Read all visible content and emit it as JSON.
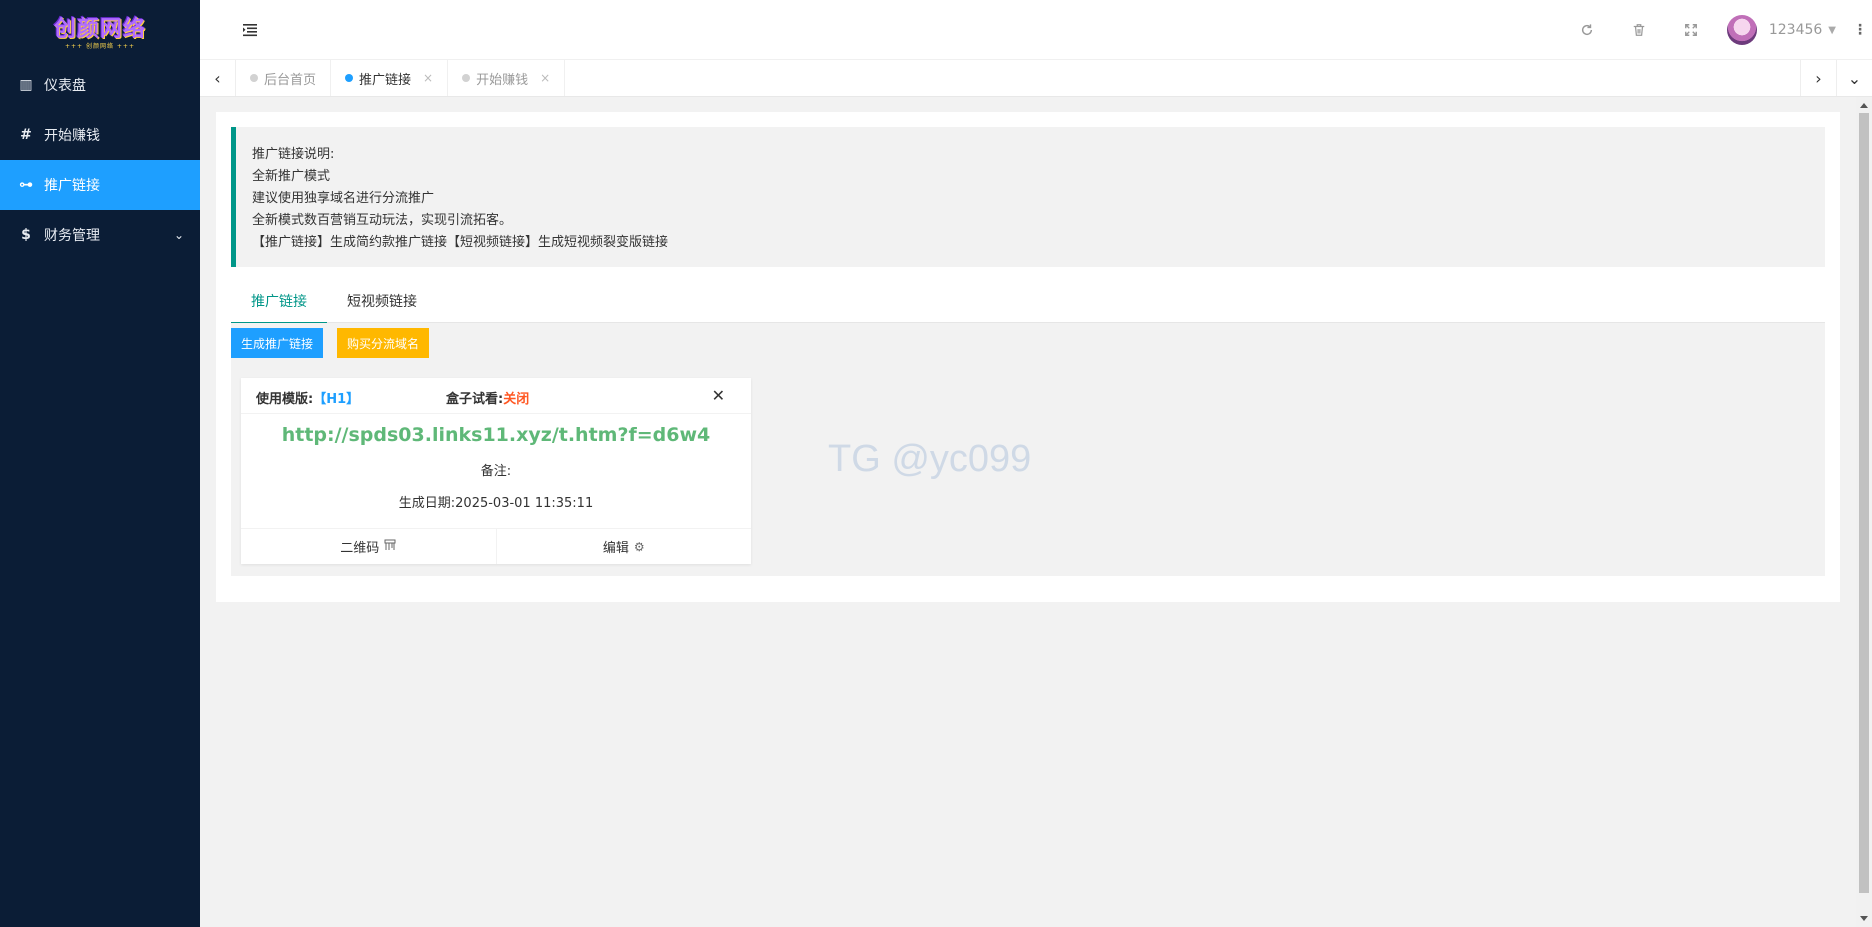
{
  "logo": {
    "title": "创颜网络",
    "subtitle": "+++ 创颜网络 +++"
  },
  "sidebar": {
    "items": [
      {
        "label": "仪表盘",
        "icon": "building-icon",
        "glyph": "▥"
      },
      {
        "label": "开始赚钱",
        "icon": "hash-icon",
        "glyph": "#"
      },
      {
        "label": "推广链接",
        "icon": "usb-icon",
        "glyph": "⊶"
      },
      {
        "label": "财务管理",
        "icon": "dollar-icon",
        "glyph": "$",
        "caret": "⌄"
      }
    ]
  },
  "header": {
    "username": "123456",
    "icons": [
      "refresh-icon",
      "trash-icon",
      "fullscreen-icon",
      "more-icon"
    ]
  },
  "page_tabs": [
    {
      "label": "后台首页"
    },
    {
      "label": "推广链接",
      "close": "×"
    },
    {
      "label": "开始赚钱",
      "close": "×"
    }
  ],
  "notice": {
    "lines": [
      "推广链接说明:",
      "全新推广模式",
      "建议使用独享域名进行分流推广",
      "全新模式数百营销互动玩法，实现引流拓客。",
      "【推广链接】生成简约款推广链接【短视频链接】生成短视频裂变版链接"
    ]
  },
  "sub_tabs": [
    "推广链接",
    "短视频链接"
  ],
  "buttons": {
    "generate": "生成推广链接",
    "buy": "购买分流域名"
  },
  "card": {
    "template_label": "使用模版:",
    "template_value": "【H1】",
    "box_label": "盒子试看:",
    "box_value": "关闭",
    "link": "http://spds03.links11.xyz/t.htm?f=d6w4",
    "remark": "备注:",
    "date": "生成日期:2025-03-01 11:35:11",
    "qr_label": "二维码",
    "edit_label": "编辑"
  },
  "watermark": "TG @yc099",
  "colors": {
    "sidebar_bg": "#0b1d36",
    "accent_blue": "#1e9fff",
    "accent_teal": "#009688",
    "warning": "#ffb800",
    "link_green": "#5fb878",
    "danger": "#ff5722"
  }
}
